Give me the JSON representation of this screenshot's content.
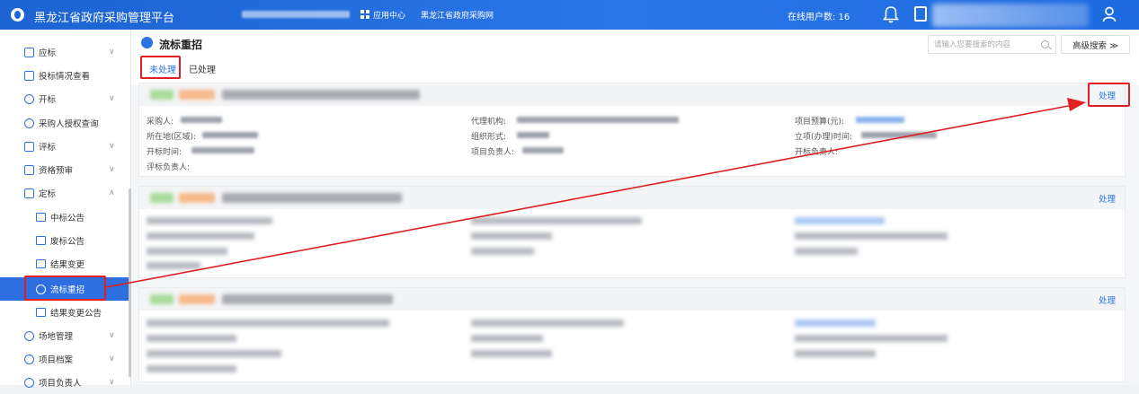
{
  "topbar": {
    "title": "黑龙江省政府采购管理平台",
    "app_center": "应用中心",
    "procurement_net": "黑龙江省政府采购网",
    "online_users": "在线用户数: 16"
  },
  "sidebar": {
    "items": [
      {
        "label": "应标",
        "icon": "calendar-icon",
        "expandable": true
      },
      {
        "label": "投标情况查看",
        "icon": "doc-search-icon",
        "expandable": false
      },
      {
        "label": "开标",
        "icon": "star-icon",
        "expandable": true
      },
      {
        "label": "采购人授权查询",
        "icon": "shield-search-icon",
        "expandable": false
      },
      {
        "label": "评标",
        "icon": "clipboard-icon",
        "expandable": true
      },
      {
        "label": "资格预审",
        "icon": "list-icon",
        "expandable": true
      },
      {
        "label": "定标",
        "icon": "check-doc-icon",
        "expandable": true
      }
    ],
    "sub_items": [
      "中标公告",
      "废标公告",
      "结果变更",
      "流标重招",
      "结果变更公告"
    ],
    "items_after": [
      {
        "label": "场地管理",
        "icon": "people-icon"
      },
      {
        "label": "项目档案",
        "icon": "archive-icon"
      },
      {
        "label": "项目负责人",
        "icon": "person-icon"
      }
    ],
    "active_item": "流标重招"
  },
  "page": {
    "title": "流标重招",
    "tabs": [
      "未处理",
      "已处理"
    ],
    "search_placeholder": "请输入您要搜索的内容",
    "advanced_search": "高级搜索 ≫"
  },
  "card": {
    "action": "处理",
    "fields": {
      "purchaser": "采购人:",
      "region": "所在地(区域):",
      "bid_open_time": "开标时间:",
      "eval_lead": "评标负责人:",
      "agency": "代理机构:",
      "org_form": "组织形式:",
      "project_lead": "项目负责人:",
      "budget": "项目预算(元):",
      "approval_time": "立项(办理)时间:",
      "open_lead": "开标负责人:"
    }
  },
  "colors": {
    "primary": "#2b74e6",
    "highlight": "#e02020",
    "topbar": "#1c63d3"
  }
}
